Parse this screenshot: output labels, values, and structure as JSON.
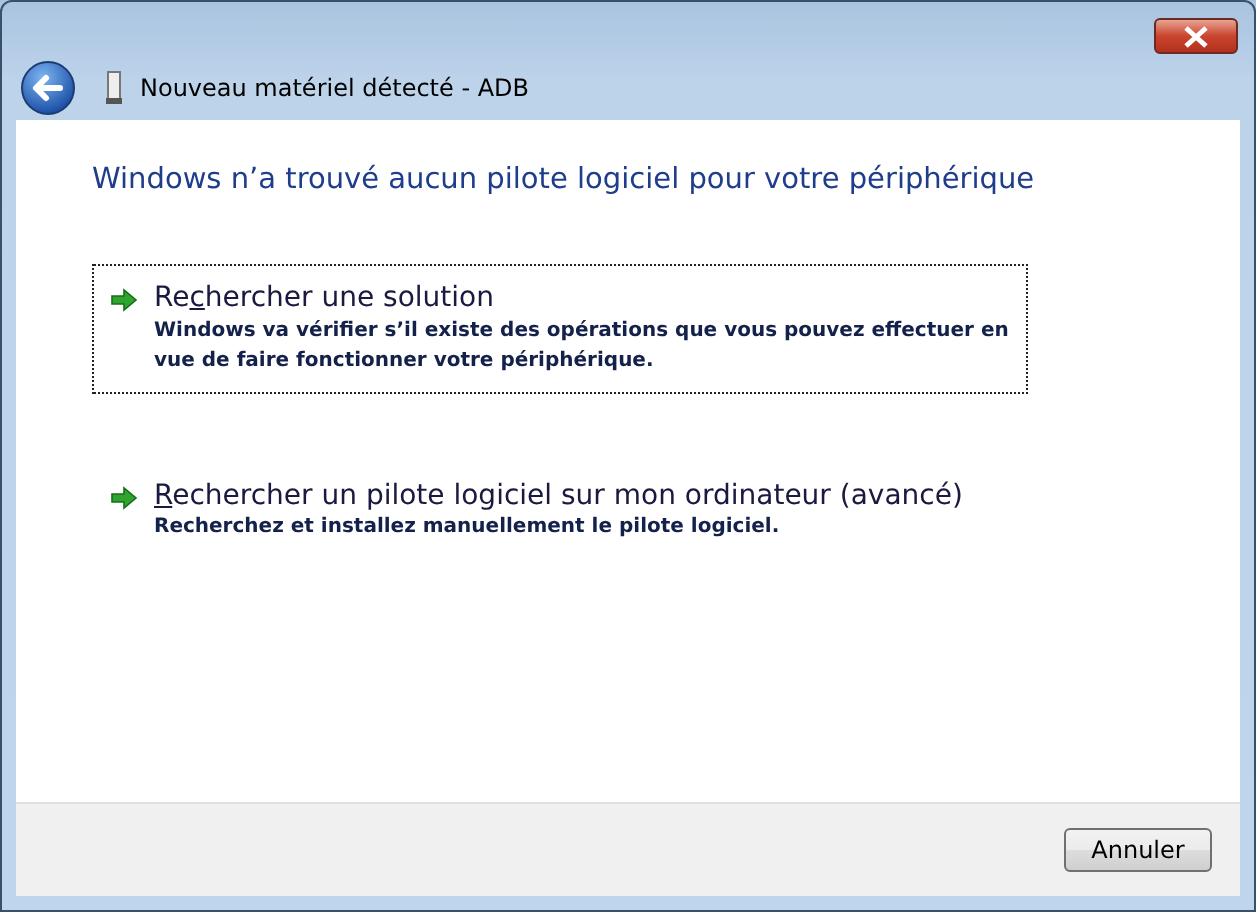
{
  "window": {
    "title": "Nouveau matériel détecté - ADB"
  },
  "heading": "Windows n’a trouvé aucun pilote logiciel pour votre périphérique",
  "options": [
    {
      "title_before": "Re",
      "access_key": "c",
      "title_after": "hercher une solution",
      "description": "Windows va vérifier s’il existe des opérations que vous pouvez effectuer en vue de faire fonctionner votre périphérique.",
      "focused": true
    },
    {
      "access_key": "R",
      "title_after": "echercher un pilote logiciel sur mon ordinateur (avancé)",
      "description": "Recherchez et installez manuellement le pilote logiciel.",
      "focused": false
    }
  ],
  "buttons": [
    "Annuler"
  ]
}
